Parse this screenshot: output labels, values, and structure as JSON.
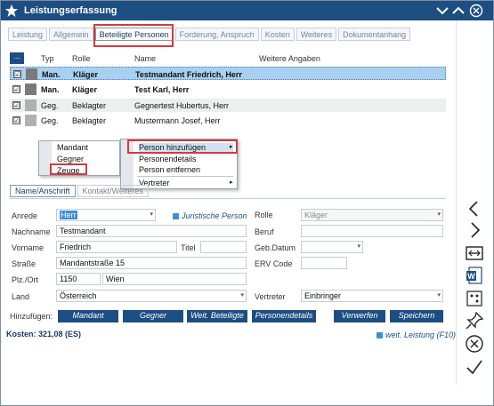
{
  "window": {
    "title": "Leistungserfassung"
  },
  "tabs": [
    "Leistung",
    "Allgemein",
    "Beteiligte Personen",
    "Forderung, Anspruch",
    "Kosten",
    "Weiteres",
    "Dokumentanhang"
  ],
  "grid": {
    "headers": [
      "...",
      "Typ",
      "Rolle",
      "Name",
      "Weitere Angaben"
    ],
    "rows": [
      {
        "typ": "Man.",
        "rolle": "Kläger",
        "name": "Testmandant Friedrich, Herr",
        "checked": "☑",
        "color": "#7a7a7a"
      },
      {
        "typ": "Man.",
        "rolle": "Kläger",
        "name": "Test Karl, Herr",
        "checked": "☑",
        "color": "#7a7a7a"
      },
      {
        "typ": "Geg.",
        "rolle": "Beklagter",
        "name": "Gegnertest Hubertus, Herr",
        "checked": "☑",
        "color": "#b0b0b0"
      },
      {
        "typ": "Geg.",
        "rolle": "Beklagter",
        "name": "Mustermann Josef, Herr",
        "checked": "☑",
        "color": "#b0b0b0"
      }
    ]
  },
  "context_menu": {
    "left_items": [
      "Mandant",
      "Gegner",
      "Zeuge"
    ],
    "right_items": [
      "Person hinzufügen",
      "Personendetails",
      "Person entfernen",
      "Vertreter"
    ]
  },
  "subtabs": [
    "Name/Anschrift",
    "Kontakt/Weiteres"
  ],
  "form": {
    "anrede_label": "Anrede",
    "anrede_value": "Herr",
    "juristische_label": "Juristische Person",
    "rolle_label": "Rolle",
    "rolle_value": "Kläger",
    "nachname_label": "Nachname",
    "nachname_value": "Testmandant",
    "beruf_label": "Beruf",
    "beruf_value": "",
    "vorname_label": "Vorname",
    "vorname_value": "Friedrich",
    "titel_label": "Titel",
    "titel_value": "",
    "gebdatum_label": "Geb.Datum",
    "gebdatum_value": "",
    "strasse_label": "Straße",
    "strasse_value": "Mandantstraße 15",
    "erv_label": "ERV Code",
    "erv_value": "",
    "plz_label": "Plz./Ort",
    "plz_value": "1150",
    "ort_value": "Wien",
    "land_label": "Land",
    "land_value": "Österreich",
    "vertreter_label": "Vertreter",
    "vertreter_value": "Einbringer"
  },
  "buttons": {
    "label": "Hinzufügen:",
    "items": [
      "Mandant",
      "Gegner",
      "Weit. Beteiligte",
      "Personendetails",
      "Verwerfen",
      "Speichern"
    ]
  },
  "footer": {
    "kosten": "Kosten: 321,08 (ES)",
    "note": "weit. Leistung (F10)"
  },
  "sidebar_icons": [
    "chevron-left-icon",
    "chevron-right-icon",
    "link-icon",
    "word-icon",
    "dots-icon",
    "pin-icon",
    "cancel-icon",
    "check-icon"
  ],
  "colors": {
    "accent": "#1c4e82",
    "selection": "#a8d0f0",
    "highlight": "#d23b3b"
  }
}
